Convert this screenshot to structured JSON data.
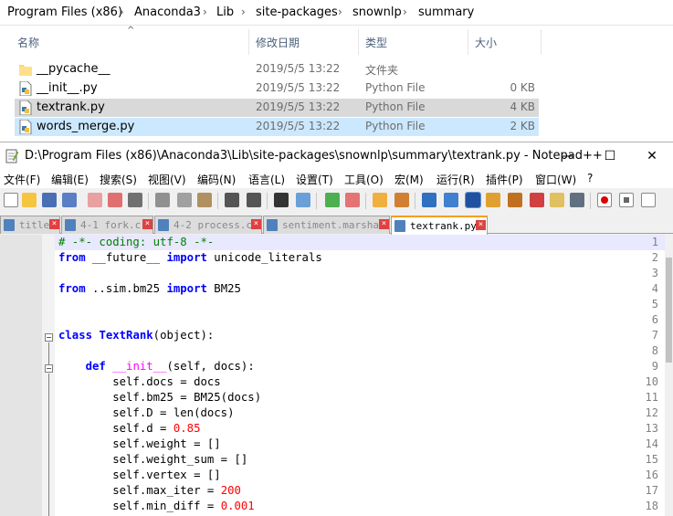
{
  "explorer": {
    "breadcrumb": [
      "Program Files (x86)",
      "Anaconda3",
      "Lib",
      "site-packages",
      "snownlp",
      "summary"
    ],
    "columns": {
      "name": "名称",
      "date": "修改日期",
      "type": "类型",
      "size": "大小"
    },
    "files": [
      {
        "name": "__pycache__",
        "date": "2019/5/5 13:22",
        "type": "文件夹",
        "size": "",
        "icon": "folder-icon"
      },
      {
        "name": "__init__.py",
        "date": "2019/5/5 13:22",
        "type": "Python File",
        "size": "0 KB",
        "icon": "python-file-icon"
      },
      {
        "name": "textrank.py",
        "date": "2019/5/5 13:22",
        "type": "Python File",
        "size": "4 KB",
        "icon": "python-file-icon"
      },
      {
        "name": "words_merge.py",
        "date": "2019/5/5 13:22",
        "type": "Python File",
        "size": "2 KB",
        "icon": "python-file-icon"
      }
    ]
  },
  "notepad": {
    "title": "D:\\Program Files (x86)\\Anaconda3\\Lib\\site-packages\\snownlp\\summary\\textrank.py - Notepad++",
    "window_buttons": {
      "minimize": "—",
      "maximize": "☐",
      "close": "✕"
    },
    "menu": [
      "文件(F)",
      "编辑(E)",
      "搜索(S)",
      "视图(V)",
      "编码(N)",
      "语言(L)",
      "设置(T)",
      "工具(O)",
      "宏(M)",
      "运行(R)",
      "插件(P)",
      "窗口(W)",
      "?"
    ],
    "tabs": [
      {
        "label": "title",
        "active": false
      },
      {
        "label": "4-1 fork.c",
        "active": false
      },
      {
        "label": "4-2 process.c",
        "active": false
      },
      {
        "label": "sentiment.marshal",
        "active": false
      },
      {
        "label": "textrank.py",
        "active": true
      }
    ],
    "line_numbers": [
      "1",
      "2",
      "3",
      "4",
      "5",
      "6",
      "7",
      "8",
      "9",
      "10",
      "11",
      "12",
      "13",
      "14",
      "15",
      "16",
      "17",
      "18"
    ],
    "code": [
      [
        {
          "t": "# -*- coding: utf-8 -*-",
          "c": "cm"
        }
      ],
      [
        {
          "t": "from",
          "c": "kw"
        },
        {
          "t": " __future__ ",
          "c": ""
        },
        {
          "t": "import",
          "c": "kw"
        },
        {
          "t": " unicode_literals",
          "c": ""
        }
      ],
      [],
      [
        {
          "t": "from",
          "c": "kw"
        },
        {
          "t": " ..sim.bm25 ",
          "c": ""
        },
        {
          "t": "import",
          "c": "kw"
        },
        {
          "t": " BM25",
          "c": ""
        }
      ],
      [],
      [],
      [
        {
          "t": "class",
          "c": "kw"
        },
        {
          "t": " ",
          "c": ""
        },
        {
          "t": "TextRank",
          "c": "kw"
        },
        {
          "t": "(object):",
          "c": ""
        }
      ],
      [],
      [
        {
          "t": "    ",
          "c": ""
        },
        {
          "t": "def",
          "c": "kw"
        },
        {
          "t": " ",
          "c": ""
        },
        {
          "t": "__init__",
          "c": "fn"
        },
        {
          "t": "(self, docs):",
          "c": ""
        }
      ],
      [
        {
          "t": "        self.docs = docs",
          "c": ""
        }
      ],
      [
        {
          "t": "        self.bm25 = BM25(docs)",
          "c": ""
        }
      ],
      [
        {
          "t": "        self.D = len(docs)",
          "c": ""
        }
      ],
      [
        {
          "t": "        self.d = ",
          "c": ""
        },
        {
          "t": "0.85",
          "c": "num"
        }
      ],
      [
        {
          "t": "        self.weight = []",
          "c": ""
        }
      ],
      [
        {
          "t": "        self.weight_sum = []",
          "c": ""
        }
      ],
      [
        {
          "t": "        self.vertex = []",
          "c": ""
        }
      ],
      [
        {
          "t": "        self.max_iter = ",
          "c": ""
        },
        {
          "t": "200",
          "c": "num"
        }
      ],
      [
        {
          "t": "        self.min_diff = ",
          "c": ""
        },
        {
          "t": "0.001",
          "c": "num"
        }
      ]
    ]
  }
}
